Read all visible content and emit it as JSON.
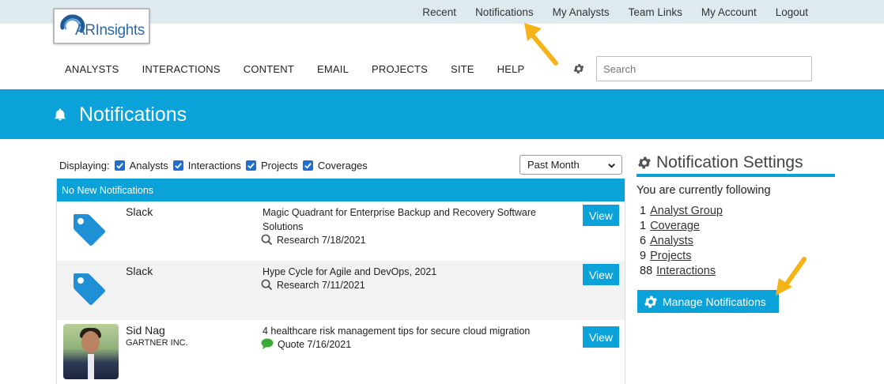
{
  "brand": {
    "logo_text": "ARInsights"
  },
  "top_nav": {
    "items": [
      "Recent",
      "Notifications",
      "My Analysts",
      "Team Links",
      "My Account",
      "Logout"
    ]
  },
  "main_nav": {
    "items": [
      "ANALYSTS",
      "INTERACTIONS",
      "CONTENT",
      "EMAIL",
      "PROJECTS",
      "SITE",
      "HELP"
    ]
  },
  "search": {
    "placeholder": "Search",
    "value": ""
  },
  "page": {
    "title": "Notifications"
  },
  "filters": {
    "label": "Displaying:",
    "options": [
      {
        "label": "Analysts",
        "checked": true
      },
      {
        "label": "Interactions",
        "checked": true
      },
      {
        "label": "Projects",
        "checked": true
      },
      {
        "label": "Coverages",
        "checked": true
      }
    ],
    "period": "Past Month"
  },
  "feed": {
    "header": "No New Notifications",
    "items": [
      {
        "who": "Slack",
        "org": "",
        "title": "Magic Quadrant for Enterprise Backup and Recovery Software Solutions",
        "type": "Research",
        "date": "7/18/2021",
        "action": "View",
        "avatar_icon": "tag-icon",
        "type_icon": "search-icon"
      },
      {
        "who": "Slack",
        "org": "",
        "title": "Hype Cycle for Agile and DevOps, 2021",
        "type": "Research",
        "date": "7/11/2021",
        "action": "View",
        "avatar_icon": "tag-icon",
        "type_icon": "search-icon"
      },
      {
        "who": "Sid Nag",
        "org": "GARTNER INC.",
        "title": "4 healthcare risk management tips for secure cloud migration",
        "type": "Quote",
        "date": "7/16/2021",
        "action": "View",
        "avatar_icon": "photo",
        "type_icon": "speech-bubble-icon"
      }
    ]
  },
  "settings": {
    "title": "Notification Settings",
    "following_label": "You are currently following",
    "items": [
      {
        "count": "1",
        "label": "Analyst Group"
      },
      {
        "count": "1",
        "label": "Coverage"
      },
      {
        "count": "6",
        "label": "Analysts"
      },
      {
        "count": "9",
        "label": "Projects"
      },
      {
        "count": "88",
        "label": "Interactions"
      }
    ],
    "manage_button": "Manage Notifications"
  },
  "colors": {
    "accent": "#0aa2d9",
    "topbar": "#dfe9f0",
    "quote_icon": "#3cab36",
    "checkbox": "#1f6fd1",
    "callout_arrow": "#f5b318"
  }
}
